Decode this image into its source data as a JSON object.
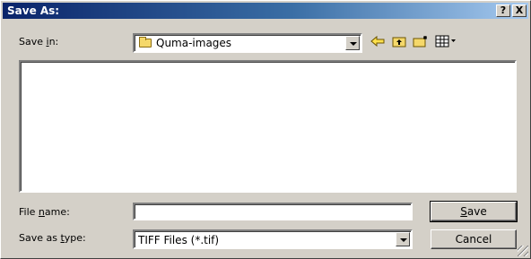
{
  "window": {
    "title": "Save As:"
  },
  "title_buttons": {
    "help": "?",
    "close": "X"
  },
  "save_in": {
    "label_pre": "Save ",
    "label_key": "i",
    "label_post": "n:",
    "value": "Quma-images"
  },
  "file_name": {
    "label_pre": "File ",
    "label_key": "n",
    "label_post": "ame:",
    "value": ""
  },
  "save_as_type": {
    "label_pre": "Save as ",
    "label_key": "t",
    "label_post": "ype:",
    "value": "TIFF Files (*.tif)"
  },
  "buttons": {
    "save_key": "S",
    "save_rest": "ave",
    "cancel": "Cancel"
  },
  "icons": {
    "back": "back-arrow-icon",
    "up": "up-folder-icon",
    "new_folder": "new-folder-icon",
    "view": "view-menu-icon"
  },
  "colors": {
    "titlebar_start": "#0a246a",
    "titlebar_end": "#a6caf0",
    "face": "#d4d0c8"
  }
}
